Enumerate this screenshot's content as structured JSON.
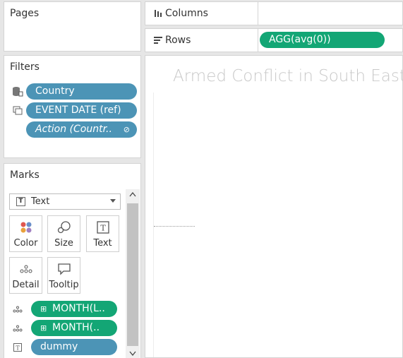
{
  "pages": {
    "title": "Pages"
  },
  "filters": {
    "title": "Filters",
    "items": [
      {
        "label": "Country",
        "icon": "database-icon"
      },
      {
        "label": "EVENT DATE (ref)",
        "icon": "copy-icon"
      },
      {
        "label": "Action (Countr..",
        "icon": "link-icon"
      }
    ]
  },
  "marks": {
    "title": "Marks",
    "mark_type": {
      "label": "Text",
      "icon": "text-box-icon"
    },
    "buttons": [
      {
        "label": "Color",
        "icon": "color-dots-icon"
      },
      {
        "label": "Size",
        "icon": "size-circles-icon"
      },
      {
        "label": "Text",
        "icon": "text-box-icon"
      },
      {
        "label": "Detail",
        "icon": "detail-dots-icon"
      },
      {
        "label": "Tooltip",
        "icon": "speech-bubble-icon"
      }
    ],
    "fields": [
      {
        "label": "MONTH(L..",
        "kind": "detail",
        "color": "green"
      },
      {
        "label": "MONTH(..",
        "kind": "detail",
        "color": "green"
      },
      {
        "label": "dummy",
        "kind": "text",
        "color": "blue"
      }
    ]
  },
  "shelves": {
    "columns": {
      "label": "Columns",
      "icon": "columns-icon"
    },
    "rows": {
      "label": "Rows",
      "icon": "rows-icon",
      "pill": "AGG(avg(0))"
    }
  },
  "view": {
    "title": "Armed Conflict in South East"
  },
  "colors": {
    "green_pill": "#13a675",
    "blue_pill": "#4c94b6"
  }
}
